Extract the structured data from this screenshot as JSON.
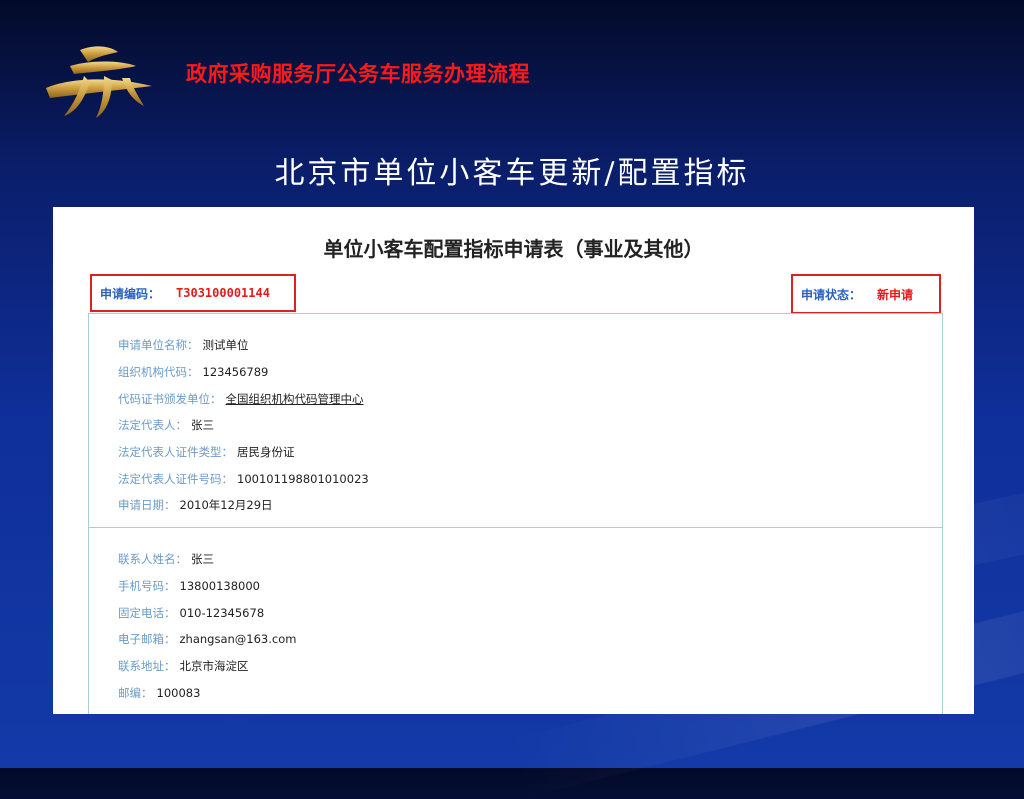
{
  "header": {
    "title": "政府采购服务厅公务车服务办理流程"
  },
  "slide": {
    "title": "北京市单位小客车更新/配置指标"
  },
  "form": {
    "heading": "单位小客车配置指标申请表（事业及其他）",
    "application_number": {
      "label": "申请编码：",
      "value": "T303100001144"
    },
    "application_status": {
      "label": "申请状态：",
      "value": "新申请"
    },
    "unit_section": [
      {
        "label": "申请单位名称：",
        "value": "测试单位"
      },
      {
        "label": "组织机构代码：",
        "value": "123456789"
      },
      {
        "label": "代码证书颁发单位：",
        "value": "全国组织机构代码管理中心"
      },
      {
        "label": "法定代表人：",
        "value": "张三"
      },
      {
        "label": "法定代表人证件类型：",
        "value": "居民身份证"
      },
      {
        "label": "法定代表人证件号码：",
        "value": "100101198801010023"
      },
      {
        "label": "申请日期：",
        "value": "2010年12月29日"
      }
    ],
    "contact_section": [
      {
        "label": "联系人姓名：",
        "value": "张三"
      },
      {
        "label": "手机号码：",
        "value": "13800138000"
      },
      {
        "label": "固定电话：",
        "value": "010-12345678"
      },
      {
        "label": "电子邮箱：",
        "value": "zhangsan@163.com"
      },
      {
        "label": "联系地址：",
        "value": "北京市海淀区"
      },
      {
        "label": "邮编：",
        "value": "100083"
      }
    ]
  },
  "colors": {
    "header_red": "#ff1a1a",
    "highlight_red": "#e02020",
    "label_blue": "#6a9bc9",
    "logo_gold": "#d9b25a"
  },
  "icons": {
    "logo": "gold-emblem-logo"
  }
}
